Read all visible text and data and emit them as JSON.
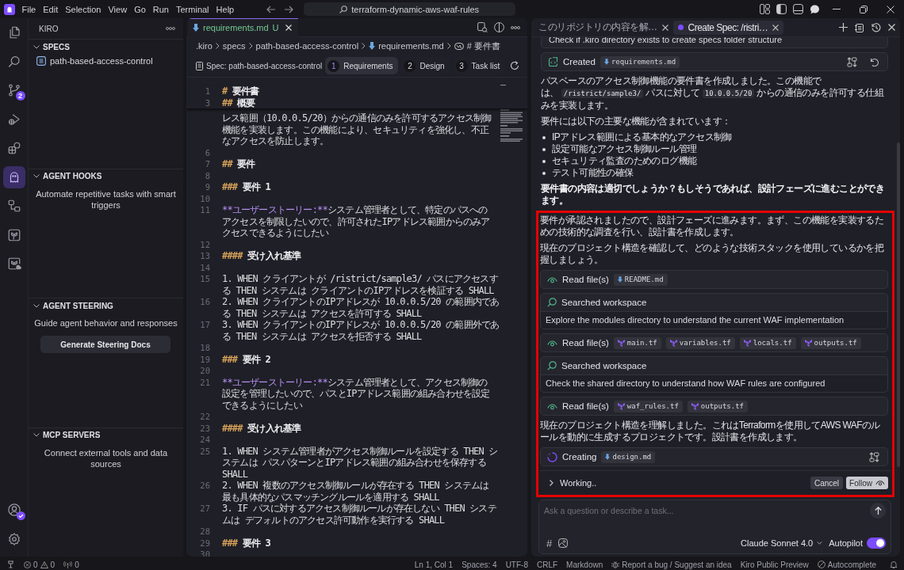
{
  "title_bar": {
    "menu": [
      "File",
      "Edit",
      "Selection",
      "View",
      "Go",
      "Run",
      "Terminal",
      "Help"
    ],
    "search": "terraform-dynamic-aws-waf-rules"
  },
  "activity_bar": {
    "items": [
      {
        "selected": false
      },
      {
        "selected": false
      },
      {
        "selected": false,
        "badge": "2"
      },
      {
        "selected": false
      },
      {
        "selected": false
      },
      {
        "selected": true
      },
      {
        "selected": false
      },
      {
        "selected": false
      },
      {
        "selected": false
      }
    ]
  },
  "sidebar": {
    "title": "KIRO",
    "sections": [
      {
        "kind": "list",
        "title": "SPECS",
        "expanded": true,
        "items": [
          "path-based-access-control"
        ]
      },
      {
        "kind": "info",
        "title": "AGENT HOOKS",
        "expanded": true,
        "description": "Automate repetitive tasks with smart triggers"
      },
      {
        "kind": "info",
        "title": "AGENT STEERING",
        "expanded": true,
        "description": "Guide agent behavior and responses",
        "button": "Generate Steering Docs"
      },
      {
        "kind": "info",
        "title": "MCP SERVERS",
        "expanded": true,
        "description": "Connect external tools and data sources"
      }
    ]
  },
  "editor": {
    "tabs": [
      {
        "label": "requirements.md",
        "status": "U",
        "selected": true
      }
    ],
    "breadcrumb": [
      {
        "kind": "folder",
        "label": ".kiro"
      },
      {
        "kind": "folder",
        "label": "specs"
      },
      {
        "kind": "folder",
        "label": "path-based-access-control"
      },
      {
        "kind": "file",
        "label": "requirements.md"
      },
      {
        "kind": "symbol",
        "label": "# 要件書"
      }
    ],
    "spec_bar": {
      "title": "Spec: path-based-access-control",
      "steps": [
        {
          "number": "1",
          "label": "Requirements",
          "selected": true
        },
        {
          "number": "2",
          "label": "Design",
          "selected": false
        },
        {
          "number": "3",
          "label": "Task list",
          "selected": false
        }
      ]
    },
    "sticky": [
      {
        "number": "1",
        "kind": "heading",
        "marker": "#",
        "text": "要件書"
      },
      {
        "number": "3",
        "kind": "heading",
        "marker": "##",
        "text": "概要"
      }
    ],
    "lines": [
      {
        "kind": "text",
        "rows": [
          "レス範囲（10.0.0.5/20）からの通信のみを許可するアクセス制御",
          "機能を実装します。この機能により、セキュリティを強化し、不正",
          "なアクセスを防止します。"
        ]
      },
      {
        "number": "6",
        "kind": "blank"
      },
      {
        "number": "7",
        "kind": "heading",
        "marker": "##",
        "text": "要件"
      },
      {
        "number": "8",
        "kind": "blank"
      },
      {
        "number": "9",
        "kind": "heading",
        "marker": "###",
        "text": "要件 1"
      },
      {
        "number": "10",
        "kind": "blank"
      },
      {
        "number": "11",
        "kind": "story",
        "label": "**ユーザーストーリー:**",
        "rows": [
          "システム管理者として、特定のパスへの",
          "アクセスを制限したいので、許可されたIPアドレス範囲からのみア",
          "クセスできるようにしたい"
        ]
      },
      {
        "number": "12",
        "kind": "blank"
      },
      {
        "number": "13",
        "kind": "heading",
        "marker": "####",
        "text": "受け入れ基準"
      },
      {
        "number": "14",
        "kind": "blank"
      },
      {
        "number": "15",
        "kind": "text",
        "rows": [
          "1. WHEN クライアントが /ristrict/sample3/ パスにアクセスす",
          "る THEN システムは クライアントのIPアドレスを検証する SHALL"
        ]
      },
      {
        "number": "16",
        "kind": "text",
        "rows": [
          "2. WHEN クライアントのIPアドレスが 10.0.0.5/20 の範囲内であ",
          "る THEN システムは アクセスを許可する SHALL"
        ]
      },
      {
        "number": "17",
        "kind": "text",
        "rows": [
          "3. WHEN クライアントのIPアドレスが 10.0.0.5/20 の範囲外であ",
          "る THEN システムは アクセスを拒否する SHALL"
        ]
      },
      {
        "number": "18",
        "kind": "blank"
      },
      {
        "number": "19",
        "kind": "heading",
        "marker": "###",
        "text": "要件 2"
      },
      {
        "number": "20",
        "kind": "blank"
      },
      {
        "number": "21",
        "kind": "story",
        "label": "**ユーザーストーリー:**",
        "rows": [
          "システム管理者として、アクセス制御の",
          "設定を管理したいので、パスとIPアドレス範囲の組み合わせを設定",
          "できるようにしたい"
        ]
      },
      {
        "number": "22",
        "kind": "blank"
      },
      {
        "number": "23",
        "kind": "heading",
        "marker": "####",
        "text": "受け入れ基準"
      },
      {
        "number": "24",
        "kind": "blank"
      },
      {
        "number": "25",
        "kind": "text",
        "rows": [
          "1. WHEN システム管理者がアクセス制御ルールを設定する THEN シ",
          "ステムは パスパターンとIPアドレス範囲の組み合わせを保存する",
          "SHALL"
        ]
      },
      {
        "number": "26",
        "kind": "text",
        "rows": [
          "2. WHEN 複数のアクセス制御ルールが存在する THEN システムは",
          "最も具体的なパスマッチングルールを適用する SHALL"
        ]
      },
      {
        "number": "27",
        "kind": "text",
        "rows": [
          "3. IF パスに対するアクセス制御ルールが存在しない THEN システ",
          "ムは デフォルトのアクセス許可動作を実行する SHALL"
        ]
      },
      {
        "number": "28",
        "kind": "blank"
      },
      {
        "number": "29",
        "kind": "heading",
        "marker": "###",
        "text": "要件 3"
      },
      {
        "number": "30",
        "kind": "blank"
      }
    ]
  },
  "chat": {
    "tabs": [
      {
        "label": "このリポジトリの内容を解…",
        "selected": false,
        "busy": false
      },
      {
        "label": "Create Spec: /ristri…",
        "selected": true,
        "busy": true
      }
    ],
    "messages": [
      {
        "kind": "detail",
        "text": "Check if .kiro directory exists to create specs folder structure"
      },
      {
        "kind": "created",
        "label": "Created",
        "files": [
          {
            "name": "requirements.md",
            "kind": "markdown"
          }
        ]
      },
      {
        "kind": "paragraph",
        "bold": false,
        "parts": [
          {
            "kind": "text",
            "text": "パスベースのアクセス制御機能の要件書を作成しました。この機能では、"
          },
          {
            "kind": "code",
            "text": "/ristrict/sample3/"
          },
          {
            "kind": "text",
            "text": "パスに対して"
          },
          {
            "kind": "code",
            "text": "10.0.0.5/20"
          },
          {
            "kind": "text",
            "text": "からの通信のみを許可する仕組みを実装します。"
          }
        ]
      },
      {
        "kind": "paragraph",
        "bold": false,
        "parts": [
          {
            "kind": "text",
            "text": "要件には以下の主要な機能が含まれています："
          }
        ]
      },
      {
        "kind": "bullets",
        "items": [
          "IPアドレス範囲による基本的なアクセス制御",
          "設定可能なアクセス制御ルール管理",
          "セキュリティ監査のためのログ機能",
          "テスト可能性の確保"
        ]
      },
      {
        "kind": "paragraph",
        "bold": true,
        "parts": [
          {
            "kind": "text",
            "text": "要件書の内容は適切でしょうか？もしそうであれば、設計フェーズに進むことができます。"
          }
        ]
      }
    ],
    "highlight": {
      "messages": [
        {
          "kind": "paragraph",
          "bold": false,
          "parts": [
            {
              "kind": "text",
              "text": "要件が承認されましたので、設計フェーズに進みます。まず、この機能を実装するための技術的な調査を行い、設計書を作成します。"
            }
          ]
        },
        {
          "kind": "paragraph",
          "bold": false,
          "parts": [
            {
              "kind": "text",
              "text": "現在のプロジェクト構造を確認して、どのような技術スタックを使用しているかを把握しましょう。"
            }
          ]
        },
        {
          "kind": "read",
          "label": "Read file(s)",
          "files": [
            {
              "name": "README.md",
              "kind": "markdown"
            }
          ]
        },
        {
          "kind": "search",
          "label": "Searched workspace",
          "detail": "Explore the modules directory to understand the current WAF implementation"
        },
        {
          "kind": "read",
          "label": "Read file(s)",
          "files": [
            {
              "name": "main.tf",
              "kind": "terraform"
            },
            {
              "name": "variables.tf",
              "kind": "terraform"
            },
            {
              "name": "locals.tf",
              "kind": "terraform"
            },
            {
              "name": "outputs.tf",
              "kind": "terraform"
            }
          ]
        },
        {
          "kind": "search",
          "label": "Searched workspace",
          "detail": "Check the shared directory to understand how WAF rules are configured"
        },
        {
          "kind": "read",
          "label": "Read file(s)",
          "files": [
            {
              "name": "waf_rules.tf",
              "kind": "terraform"
            },
            {
              "name": "outputs.tf",
              "kind": "terraform"
            }
          ]
        },
        {
          "kind": "paragraph",
          "bold": false,
          "parts": [
            {
              "kind": "text",
              "text": "現在のプロジェクト構造を理解しました。これはTerraformを使用してAWS WAFのルールを動的に生成するプロジェクトです。設計書を作成します。"
            }
          ]
        },
        {
          "kind": "creating",
          "label": "Creating",
          "files": [
            {
              "name": "design.md",
              "kind": "markdown"
            }
          ]
        }
      ]
    },
    "working": {
      "label": "Working..",
      "expanded": false,
      "cancel": "Cancel",
      "follow": "Follow"
    },
    "input": {
      "placeholder": "Ask a question or describe a task...",
      "context": "#",
      "model": "Claude Sonnet 4.0",
      "autopilot": {
        "label": "Autopilot",
        "on": true
      }
    }
  },
  "status_bar": {
    "errors": "0",
    "warnings": "0",
    "ports": "0",
    "items": [
      {
        "kind": "text",
        "label": "Ln 1, Col 1"
      },
      {
        "kind": "text",
        "label": "Spaces: 4"
      },
      {
        "kind": "text",
        "label": "UTF-8"
      },
      {
        "kind": "text",
        "label": "CRLF"
      },
      {
        "kind": "text",
        "label": "Markdown"
      },
      {
        "kind": "bug",
        "label": "Report a bug / Suggest an idea"
      },
      {
        "kind": "text",
        "label": "Kiro Public Preview"
      },
      {
        "kind": "autocomplete",
        "label": "Autocomplete"
      }
    ]
  }
}
